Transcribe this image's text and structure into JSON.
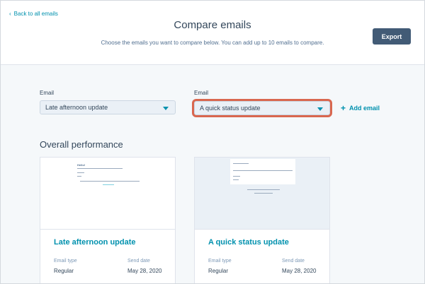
{
  "header": {
    "back_label": "Back to all emails",
    "title": "Compare emails",
    "subtitle": "Choose the emails you want to compare below. You can add up to 10 emails to compare.",
    "export_label": "Export"
  },
  "selectors": [
    {
      "label": "Email",
      "value": "Late afternoon update"
    },
    {
      "label": "Email",
      "value": "A quick status update"
    }
  ],
  "add_email_label": "Add email",
  "section_title": "Overall performance",
  "cards": [
    {
      "name": "Late afternoon update",
      "type_label": "Email type",
      "type_value": "Regular",
      "date_label": "Send date",
      "date_value": "May 28, 2020",
      "preview_greeting": "Hello!"
    },
    {
      "name": "A quick status update",
      "type_label": "Email type",
      "type_value": "Regular",
      "date_label": "Send date",
      "date_value": "May 28, 2020"
    }
  ],
  "colors": {
    "accent": "#0091ae",
    "button": "#425b76",
    "highlight": "#d9674f"
  },
  "icons": {
    "back": "chevron-left-icon",
    "caret": "caret-down-icon",
    "add": "plus-icon"
  }
}
